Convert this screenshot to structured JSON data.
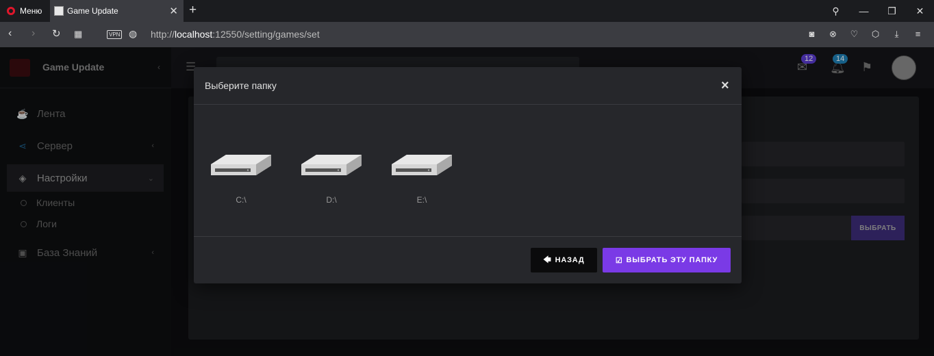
{
  "browser": {
    "menu_label": "Меню",
    "tab_title": "Game Update",
    "vpn_label": "VPN",
    "url_host": "localhost",
    "url_prefix": "http://",
    "url_rest": ":12550/setting/games/set"
  },
  "app": {
    "brand_title": "Game Update",
    "sidebar": {
      "items": [
        {
          "label": "Лента",
          "icon": "coffee-icon"
        },
        {
          "label": "Сервер",
          "icon": "share-icon"
        },
        {
          "label": "Настройки",
          "icon": "layers-icon"
        },
        {
          "label": "База Знаний",
          "icon": "briefcase-icon"
        }
      ],
      "subitems": [
        "Клиенты",
        "Логи"
      ]
    },
    "header": {
      "mail_badge": "12",
      "bell_badge": "14",
      "mail_badge_color": "#5a3bd0",
      "bell_badge_color": "#1e7fb5"
    },
    "choose_button": "ВЫБРАТЬ"
  },
  "modal": {
    "title": "Выберите папку",
    "close": "×",
    "drives": [
      {
        "label": "C:\\"
      },
      {
        "label": "D:\\"
      },
      {
        "label": "E:\\"
      }
    ],
    "back_button": "НАЗАД",
    "select_button": "ВЫБРАТЬ ЭТУ ПАПКУ",
    "accent_color": "#7a3ae6"
  }
}
